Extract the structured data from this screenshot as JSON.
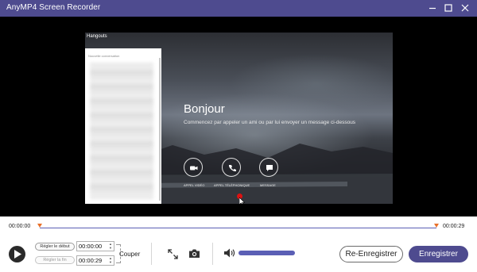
{
  "window": {
    "title": "AnyMP4 Screen Recorder",
    "controls": [
      "minimize-icon",
      "maximize-icon",
      "close-icon"
    ]
  },
  "preview": {
    "app_label": "Hangouts",
    "panel_header": "Nouvelle conversation",
    "greeting": "Bonjour",
    "subtitle": "Commencez par appeler un ami ou par lui envoyer un message ci-dessous",
    "actions": [
      {
        "icon": "video-camera-icon",
        "label": "APPEL VIDÉO"
      },
      {
        "icon": "phone-icon",
        "label": "APPEL TÉLÉPHONIQUE"
      },
      {
        "icon": "chat-bubble-icon",
        "label": "MESSAGE"
      }
    ]
  },
  "timeline": {
    "start_time": "00:00:00",
    "end_time": "00:00:29",
    "start_marker": 0.0,
    "end_marker": 1.0
  },
  "controls": {
    "play_icon": "play-icon",
    "set_start_label": "Régler le début",
    "set_start_value": "00:00:00",
    "set_end_label": "Régler la fin",
    "set_end_value": "00:00:29",
    "cut_label": "Couper",
    "fullscreen_icon": "expand-icon",
    "snapshot_icon": "camera-icon",
    "volume_icon": "speaker-icon",
    "volume_level": 1.0,
    "rerecord_label": "Re-Enregistrer",
    "save_label": "Enregistrer"
  },
  "colors": {
    "accent": "#4e4b8f",
    "timeline_track": "#5b5fb5",
    "marker": "#e8702a"
  }
}
